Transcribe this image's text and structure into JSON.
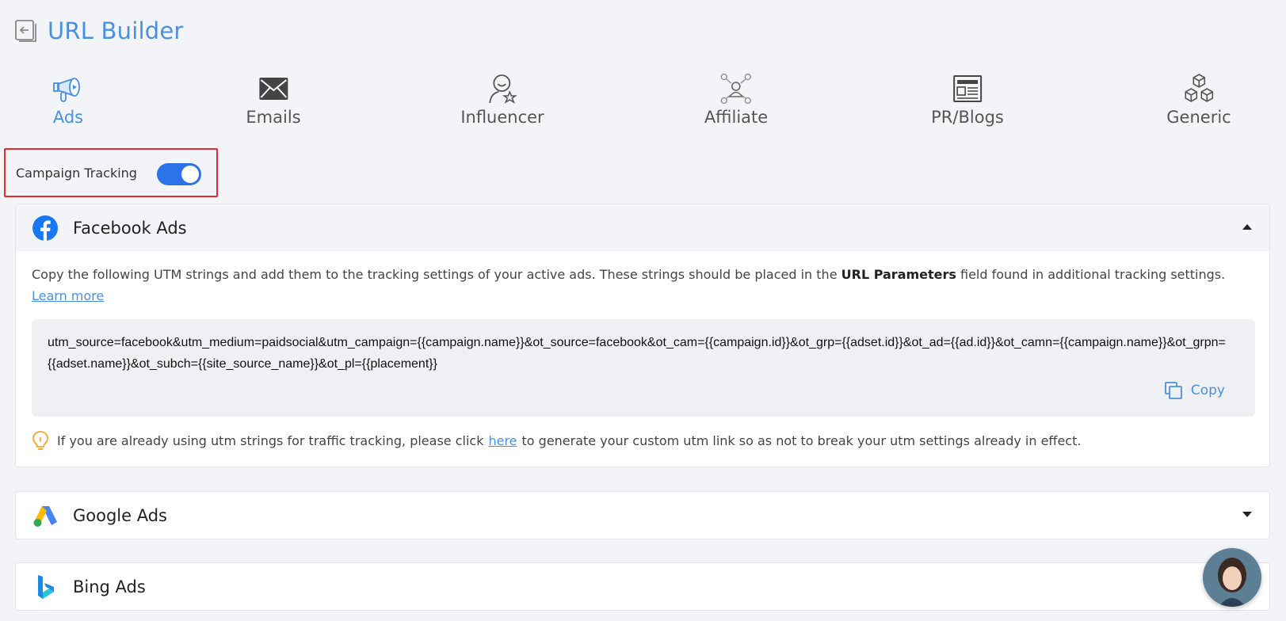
{
  "header": {
    "title": "URL Builder",
    "back_icon": "back-arrow-icon"
  },
  "tabs": [
    {
      "label": "Ads",
      "icon": "megaphone-icon",
      "active": true
    },
    {
      "label": "Emails",
      "icon": "envelope-icon",
      "active": false
    },
    {
      "label": "Influencer",
      "icon": "influencer-icon",
      "active": false
    },
    {
      "label": "Affiliate",
      "icon": "affiliate-network-icon",
      "active": false
    },
    {
      "label": "PR/Blogs",
      "icon": "newspaper-icon",
      "active": false
    },
    {
      "label": "Generic",
      "icon": "cubes-icon",
      "active": false
    }
  ],
  "campaign_tracking": {
    "label": "Campaign Tracking",
    "enabled": true
  },
  "facebook": {
    "title": "Facebook Ads",
    "desc_before": "Copy the following UTM strings and add them to the tracking settings of your active ads. These strings should be placed in the ",
    "desc_bold": "URL Parameters",
    "desc_after": " field found in additional tracking settings. ",
    "learn_more": "Learn more",
    "utm_string": "utm_source=facebook&utm_medium=paidsocial&utm_campaign={{campaign.name}}&ot_source=facebook&ot_cam={{campaign.id}}&ot_grp={{adset.id}}&ot_ad={{ad.id}}&ot_camn={{campaign.name}}&ot_grpn={{adset.name}}&ot_subch={{site_source_name}}&ot_pl={{placement}}",
    "copy_label": "Copy",
    "tip_before": "If you are already using utm strings for traffic tracking, please click ",
    "tip_link": "here",
    "tip_after": " to generate your custom utm link so as not to break your utm settings already in effect."
  },
  "google": {
    "title": "Google Ads"
  },
  "bing": {
    "title": "Bing Ads"
  },
  "colors": {
    "accent": "#4a90e2",
    "toggle": "#2e72e8",
    "highlight": "#e52b2b"
  }
}
